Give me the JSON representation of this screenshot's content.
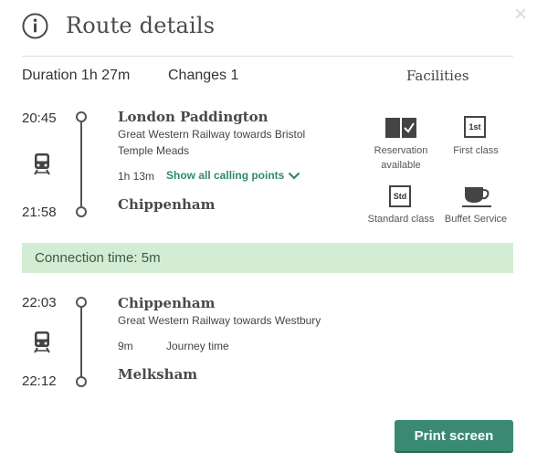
{
  "header": {
    "title": "Route details",
    "close_symbol": "×",
    "icon": "info-icon"
  },
  "summary": {
    "duration": "Duration 1h 27m",
    "changes": "Changes 1"
  },
  "facilities": {
    "heading": "Facilities",
    "items": [
      {
        "icon": "reservation-icon",
        "label_line1": "Reservation",
        "label_line2": "available"
      },
      {
        "icon": "first-class-icon",
        "label_line1": "First class",
        "badge": "1st"
      },
      {
        "icon": "standard-class-icon",
        "label_line1": "Standard class",
        "badge": "Std"
      },
      {
        "icon": "buffet-icon",
        "label_line1": "Buffet Service"
      }
    ]
  },
  "legs": [
    {
      "depart_time": "20:45",
      "depart_station": "London Paddington",
      "operator_line1": "Great Western Railway towards Bristol",
      "operator_line2": "Temple Meads",
      "duration": "1h 13m",
      "calling_points": "Show all calling points",
      "arrive_time": "21:58",
      "arrive_station": "Chippenham"
    },
    {
      "depart_time": "22:03",
      "depart_station": "Chippenham",
      "operator_line1": "Great Western Railway towards Westbury",
      "duration": "9m",
      "journey_time_label": "Journey time",
      "arrive_time": "22:12",
      "arrive_station": "Melksham"
    }
  ],
  "connection": {
    "text": "Connection time: 5m"
  },
  "actions": {
    "print_label": "Print screen"
  },
  "colors": {
    "accent": "#3a8a73",
    "link": "#2f8a6e",
    "connection_bg": "#d3ecd4"
  }
}
